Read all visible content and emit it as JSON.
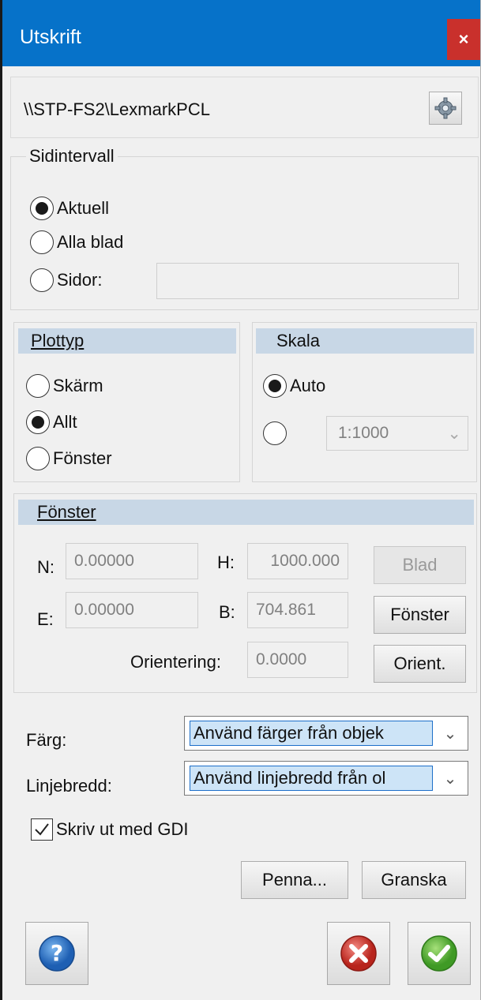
{
  "window": {
    "title": "Utskrift",
    "close_label": "×"
  },
  "printer": {
    "name": "\\\\STP-FS2\\LexmarkPCL"
  },
  "page_range": {
    "title": "Sidintervall",
    "options": [
      "Aktuell",
      "Alla blad",
      "Sidor:"
    ],
    "selected": "Aktuell",
    "pages_value": ""
  },
  "plot_type": {
    "title": "Plottyp",
    "options": [
      "Skärm",
      "Allt",
      "Fönster"
    ],
    "selected": "Allt"
  },
  "scale": {
    "title": "Skala",
    "auto_label": "Auto",
    "selected": "Auto",
    "ratio": "1:1000"
  },
  "window_section": {
    "title": "Fönster",
    "n_label": "N:",
    "n_value": "0.00000",
    "e_label": "E:",
    "e_value": "0.00000",
    "h_label": "H:",
    "h_value": "1000.000",
    "b_label": "B:",
    "b_value": "704.861",
    "orientation_label": "Orientering:",
    "orientation_value": "0.0000",
    "blad_button": "Blad",
    "fonster_button": "Fönster",
    "orient_button": "Orient."
  },
  "color": {
    "label": "Färg:",
    "value": "Använd färger från objek"
  },
  "line_width": {
    "label": "Linjebredd:",
    "value": "Använd linjebredd från ol"
  },
  "gdi": {
    "label": "Skriv ut med GDI",
    "checked": true
  },
  "pen_button": "Penna...",
  "preview_button": "Granska",
  "colors": {
    "titlebar": "#0672c9",
    "close": "#c9302c",
    "section_header": "#c8d7e6"
  }
}
